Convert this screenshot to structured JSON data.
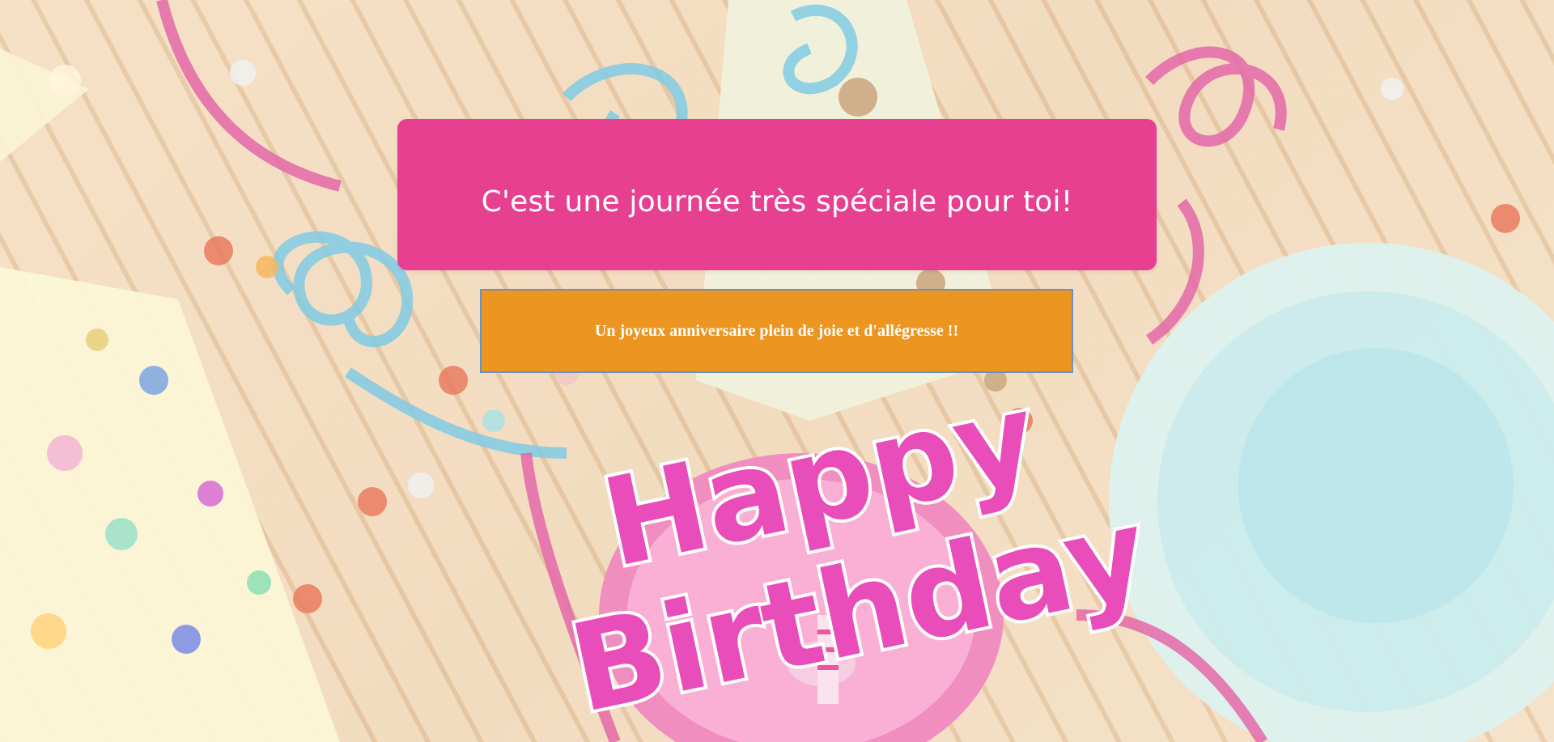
{
  "headline": {
    "text": "C'est une journée très spéciale pour toi!"
  },
  "wish_banner": {
    "text": "Un joyeux anniversaire plein de joie et d'allégresse !!"
  },
  "background_art": {
    "logo_line1": "Happy",
    "logo_line2": "Birthday"
  },
  "colors": {
    "headline_bg": "#e84090",
    "banner_bg": "#ec9520",
    "banner_border": "#6a92c2",
    "text": "#ffffff",
    "logo_pink": "#e535b0"
  }
}
